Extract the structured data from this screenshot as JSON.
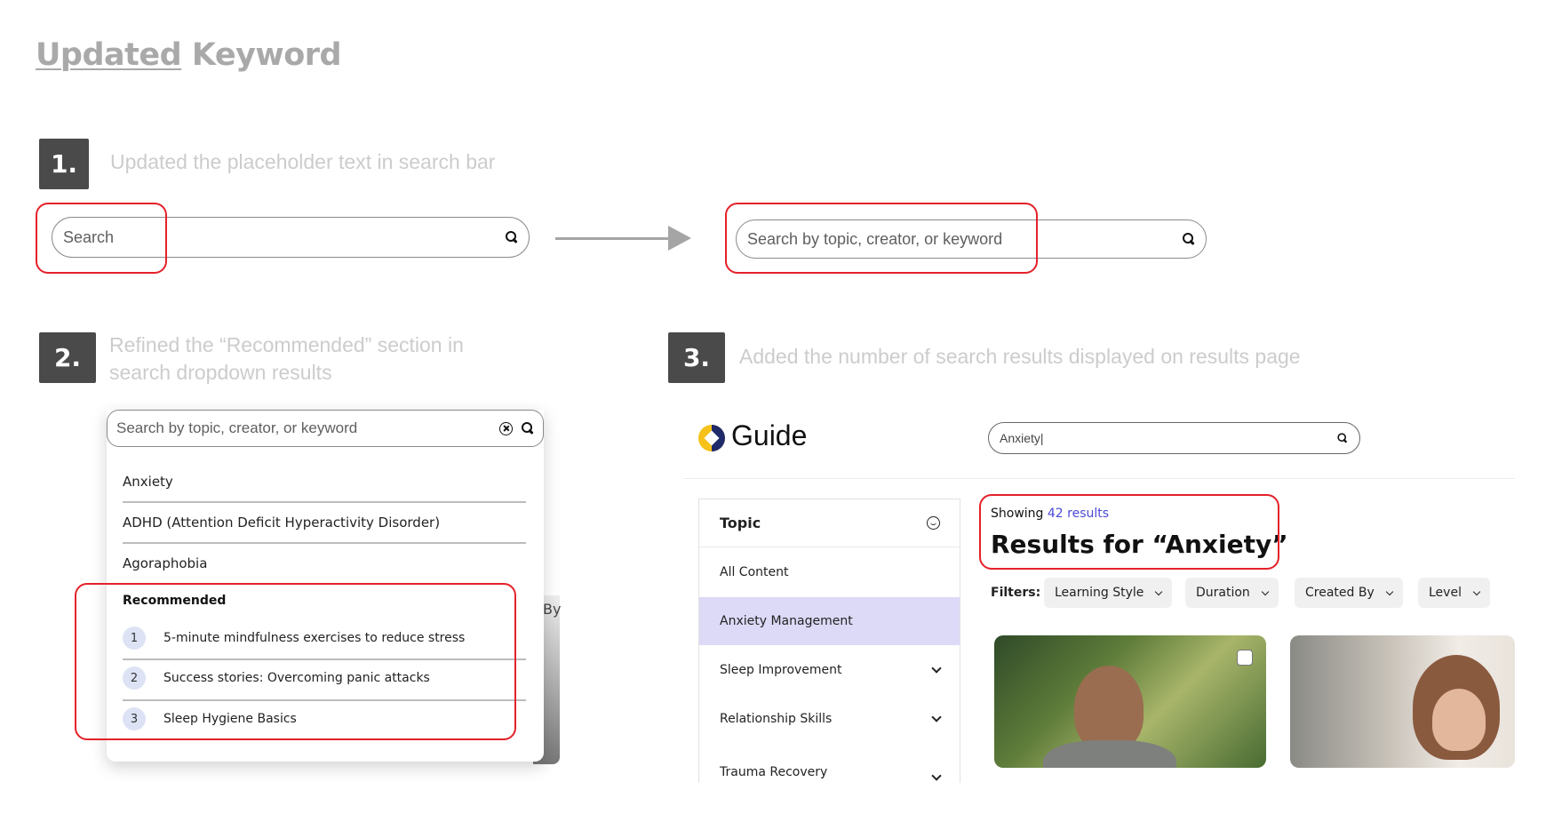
{
  "title": {
    "part1": "Updated",
    "part2": "Keyword"
  },
  "steps": [
    {
      "num": "1.",
      "text": "Updated the placeholder text in search bar"
    },
    {
      "num": "2.",
      "text_line1": "Refined the “Recommended” section in",
      "text_line2": "search dropdown results"
    },
    {
      "num": "3.",
      "text": "Added the number of search results displayed on results page"
    }
  ],
  "before_search": {
    "placeholder": "Search"
  },
  "after_search": {
    "placeholder": "Search by topic, creator, or keyword"
  },
  "dropdown": {
    "placeholder": "Search by topic, creator, or keyword",
    "suggestions": [
      "Anxiety",
      "ADHD (Attention Deficit Hyperactivity Disorder)",
      "Agoraphobia"
    ],
    "recommended_label": "Recommended",
    "recommended": [
      {
        "num": "1",
        "text": "5-minute mindfulness exercises to reduce stress"
      },
      {
        "num": "2",
        "text": "Success stories: Overcoming panic attacks"
      },
      {
        "num": "3",
        "text": "Sleep Hygiene Basics"
      }
    ],
    "behind_text": "By"
  },
  "app": {
    "logo": "Guide",
    "search_value": "Anxiety|",
    "sidebar": {
      "header": "Topic",
      "items": [
        "All Content",
        "Anxiety Management",
        "Sleep Improvement",
        "Relationship Skills",
        "Trauma Recovery"
      ]
    },
    "showing_prefix": "Showing",
    "showing_count": "42 results",
    "results_title": "Results for “Anxiety”",
    "filters_label": "Filters:",
    "filters": [
      "Learning Style",
      "Duration",
      "Created By",
      "Level"
    ]
  },
  "colors": {
    "highlight": "#e4212a",
    "accent": "#4b49d6",
    "badge": "#4a4a4a",
    "selected_row": "#dcdaf7",
    "logo_yellow": "#f6c21a",
    "logo_navy": "#1f2a6b"
  }
}
